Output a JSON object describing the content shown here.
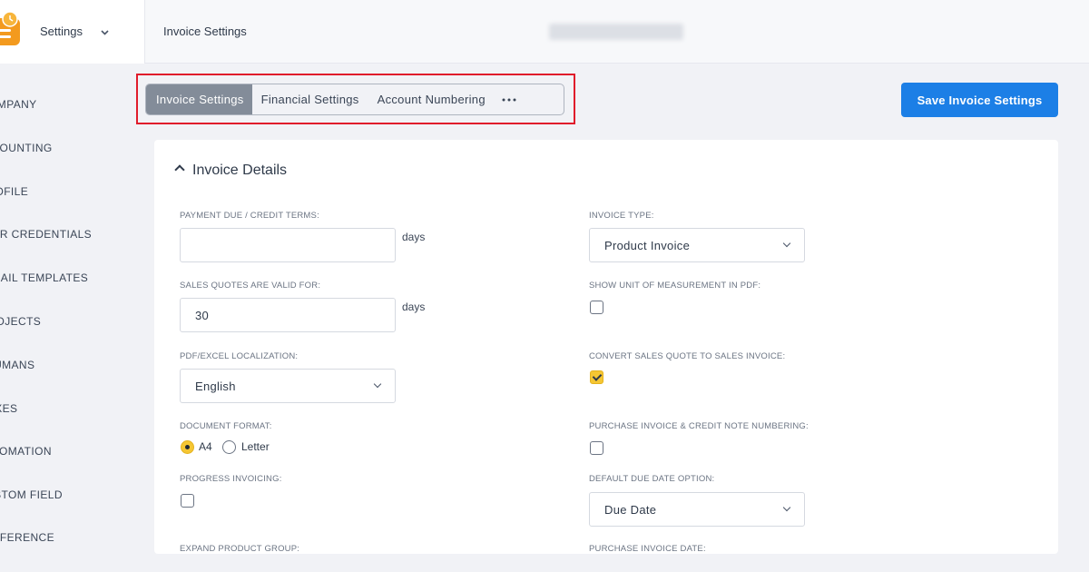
{
  "header": {
    "module": "Settings",
    "breadcrumb": "Invoice Settings"
  },
  "sidebar": {
    "items": [
      {
        "label": "COMPANY"
      },
      {
        "label": "ACCOUNTING"
      },
      {
        "label": "PROFILE"
      },
      {
        "label": "USER CREDENTIALS"
      },
      {
        "label": "EMAIL TEMPLATES"
      },
      {
        "label": "PROJECTS"
      },
      {
        "label": "HUMANS"
      },
      {
        "label": "TAXES"
      },
      {
        "label": "AUTOMATION"
      },
      {
        "label": "CUSTOM FIELD"
      },
      {
        "label": "PREFERENCE"
      }
    ]
  },
  "tabs": [
    {
      "label": "Invoice Settings",
      "active": true
    },
    {
      "label": "Financial Settings",
      "active": false
    },
    {
      "label": "Account Numbering",
      "active": false
    }
  ],
  "tabs_more": "•••",
  "save_button": "Save Invoice Settings",
  "section": {
    "title": "Invoice Details"
  },
  "fields": {
    "payment_due_label": "PAYMENT DUE / CREDIT TERMS:",
    "payment_due_value": "",
    "payment_due_suffix": "days",
    "quotes_valid_label": "SALES QUOTES ARE VALID FOR:",
    "quotes_valid_value": "30",
    "quotes_valid_suffix": "days",
    "localization_label": "PDF/EXCEL LOCALIZATION:",
    "localization_value": "English",
    "document_format_label": "DOCUMENT FORMAT:",
    "document_format_options": [
      "A4",
      "Letter"
    ],
    "document_format_selected": "A4",
    "progress_invoicing_label": "PROGRESS INVOICING:",
    "progress_invoicing_checked": false,
    "expand_group_label": "EXPAND PRODUCT GROUP:",
    "invoice_type_label": "INVOICE TYPE:",
    "invoice_type_value": "Product Invoice",
    "show_uom_label": "SHOW UNIT OF MEASUREMENT IN PDF:",
    "show_uom_checked": false,
    "convert_quote_label": "CONVERT SALES QUOTE TO SALES INVOICE:",
    "convert_quote_checked": true,
    "purchase_numbering_label": "PURCHASE INVOICE & CREDIT NOTE NUMBERING:",
    "purchase_numbering_checked": false,
    "default_due_label": "DEFAULT DUE DATE OPTION:",
    "default_due_value": "Due Date",
    "purchase_date_label": "PURCHASE INVOICE DATE:"
  },
  "colors": {
    "accent_blue": "#1c7fe6",
    "active_tab": "#838c99",
    "highlight_red": "#e01c2b",
    "check_yellow": "#f5c633"
  },
  "icons": [
    "app-logo-icon",
    "chevron-down-icon",
    "chevron-up-icon",
    "more-icon"
  ]
}
